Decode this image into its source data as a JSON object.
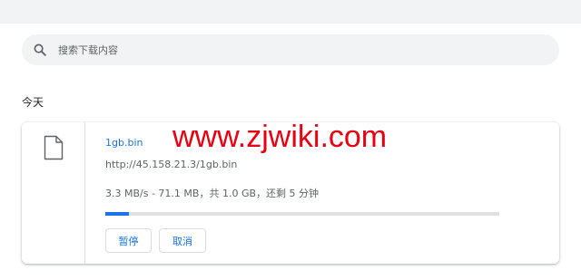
{
  "search": {
    "placeholder": "搜索下载内容",
    "icon": "search-icon"
  },
  "section": {
    "date_heading": "今天"
  },
  "download": {
    "file_name": "1gb.bin",
    "url": "http://45.158.21.3/1gb.bin",
    "status": "3.3 MB/s - 71.1 MB，共 1.0 GB，还剩 5 分钟",
    "progress_fraction": 0.06,
    "file_icon": "file-icon",
    "pause_label": "暂停",
    "cancel_label": "取消"
  },
  "watermark": {
    "text": "www.zjwiki.com",
    "color": "#e60012"
  },
  "colors": {
    "accent": "#1a73e8",
    "search_background": "#f1f3f4",
    "secondary_text": "#5f6368"
  }
}
